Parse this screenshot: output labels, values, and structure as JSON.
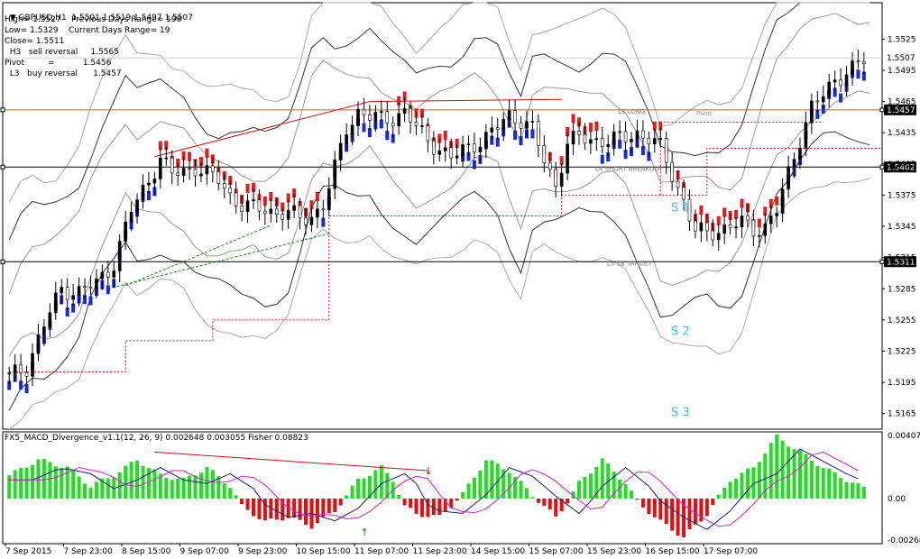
{
  "symbol_header": "GBPUSD,H1  1.5501 1.5519 1.5497 1.5507",
  "info_lines": [
    "High= 1.5527    Previous Days Range= 198",
    "Low= 1.5329    Current Days Range= 19",
    "Close= 1.5511",
    "  H3   sell reversal     1.5565",
    "Pivot         =           1.5456",
    "  L3   buy reversal      1.5457"
  ],
  "indicator_title": "FX5_MACD_Divergence_v1.1(12, 26, 9) 0.002648 0.003055  Fisher 0.08823",
  "chart_data": [
    {
      "type": "candlestick",
      "symbol": "GBPUSD",
      "timeframe": "H1",
      "ylim": [
        1.515,
        1.556
      ],
      "ytick_labels": [
        "1.5525",
        "1.5495",
        "1.5465",
        "1.5435",
        "1.5405",
        "1.5375",
        "1.5345",
        "1.5315",
        "1.5285",
        "1.5255",
        "1.5225",
        "1.5195",
        "1.5165"
      ],
      "xtick_labels": [
        "7 Sep 2015",
        "7 Sep 23:00",
        "8 Sep 15:00",
        "9 Sep 07:00",
        "9 Sep 23:00",
        "10 Sep 15:00",
        "11 Sep 07:00",
        "11 Sep 23:00",
        "14 Sep 15:00",
        "15 Sep 07:00",
        "15 Sep 23:00",
        "16 Sep 15:00",
        "17 Sep 07:00"
      ],
      "close_path": [
        [
          0,
          1.52
        ],
        [
          3,
          1.521
        ],
        [
          6,
          1.525
        ],
        [
          9,
          1.5285
        ],
        [
          12,
          1.5282
        ],
        [
          15,
          1.529
        ],
        [
          18,
          1.531
        ],
        [
          21,
          1.536
        ],
        [
          24,
          1.539
        ],
        [
          26,
          1.541
        ],
        [
          28,
          1.5395
        ],
        [
          30,
          1.5398
        ],
        [
          32,
          1.5402
        ],
        [
          34,
          1.5395
        ],
        [
          36,
          1.539
        ],
        [
          38,
          1.5375
        ],
        [
          40,
          1.5365
        ],
        [
          42,
          1.5362
        ],
        [
          44,
          1.5362
        ],
        [
          46,
          1.5358
        ],
        [
          48,
          1.5358
        ],
        [
          50,
          1.5352
        ],
        [
          52,
          1.5355
        ],
        [
          54,
          1.5365
        ],
        [
          56,
          1.54
        ],
        [
          58,
          1.544
        ],
        [
          60,
          1.5455
        ],
        [
          62,
          1.545
        ],
        [
          64,
          1.5448
        ],
        [
          66,
          1.545
        ],
        [
          68,
          1.5455
        ],
        [
          70,
          1.544
        ],
        [
          72,
          1.5428
        ],
        [
          74,
          1.542
        ],
        [
          76,
          1.541
        ],
        [
          78,
          1.5418
        ],
        [
          80,
          1.5425
        ],
        [
          82,
          1.543
        ],
        [
          84,
          1.544
        ],
        [
          86,
          1.5452
        ],
        [
          88,
          1.5448
        ],
        [
          90,
          1.5438
        ],
        [
          92,
          1.5408
        ],
        [
          94,
          1.5385
        ],
        [
          96,
          1.5425
        ],
        [
          98,
          1.543
        ],
        [
          100,
          1.5428
        ],
        [
          102,
          1.5428
        ],
        [
          104,
          1.5428
        ],
        [
          106,
          1.543
        ],
        [
          108,
          1.5435
        ],
        [
          110,
          1.543
        ],
        [
          112,
          1.542
        ],
        [
          114,
          1.5395
        ],
        [
          116,
          1.537
        ],
        [
          118,
          1.534
        ],
        [
          120,
          1.5338
        ],
        [
          122,
          1.5342
        ],
        [
          124,
          1.5345
        ],
        [
          126,
          1.5348
        ],
        [
          128,
          1.5342
        ],
        [
          130,
          1.5345
        ],
        [
          132,
          1.536
        ],
        [
          134,
          1.5395
        ],
        [
          136,
          1.543
        ],
        [
          138,
          1.546
        ],
        [
          140,
          1.547
        ],
        [
          142,
          1.5485
        ],
        [
          144,
          1.5495
        ],
        [
          146,
          1.55
        ],
        [
          148,
          1.5507
        ]
      ],
      "bar_count": 150,
      "horizontal_lines": [
        {
          "value": 1.5457,
          "label": "1.5457",
          "color": "#cc6600",
          "text": "L3 LONG"
        },
        {
          "value": 1.5402,
          "label": "1.5402",
          "color": "#000000",
          "text": "L4 SHORT BREAKOUT"
        },
        {
          "value": 1.5311,
          "label": "1.5311",
          "color": "#000000",
          "text": "L5 SB TARGET"
        }
      ],
      "pivot_label": "Pivot",
      "support_labels": [
        "S 1",
        "S 2",
        "S 3"
      ],
      "support_values": [
        1.5363,
        1.5244,
        1.5166
      ],
      "current_price_label": "1.5507",
      "current_price": 1.5507,
      "colors": {
        "up_trend": "#1a2bd4",
        "down_trend": "#dd2020",
        "candle": "#000000",
        "level_line": "#cc6600",
        "support_text": "#44c6d8",
        "red_dash": "#cc1111",
        "green_dash": "#118811"
      }
    },
    {
      "type": "histogram",
      "name": "FX5_MACD_Divergence_v1.1",
      "ylim": [
        -0.00268,
        0.00407
      ],
      "ytick_labels": [
        "0.00407",
        "0.00",
        "-0.00268"
      ],
      "values_profile": [
        [
          0,
          0.0015
        ],
        [
          5,
          0.0025
        ],
        [
          10,
          0.002
        ],
        [
          14,
          0.0008
        ],
        [
          18,
          0.0015
        ],
        [
          22,
          0.0025
        ],
        [
          26,
          0.0015
        ],
        [
          30,
          0.0012
        ],
        [
          34,
          0.002
        ],
        [
          38,
          0.0008
        ],
        [
          40,
          -0.0005
        ],
        [
          44,
          -0.0015
        ],
        [
          48,
          -0.0012
        ],
        [
          52,
          -0.0018
        ],
        [
          56,
          -0.0008
        ],
        [
          60,
          0.0012
        ],
        [
          64,
          0.002
        ],
        [
          66,
          0.0012
        ],
        [
          68,
          -0.0005
        ],
        [
          70,
          -0.001
        ],
        [
          74,
          -0.0012
        ],
        [
          78,
          0.0003
        ],
        [
          82,
          0.0025
        ],
        [
          86,
          0.0018
        ],
        [
          90,
          0.0002
        ],
        [
          92,
          -0.0005
        ],
        [
          94,
          -0.0012
        ],
        [
          96,
          -0.0002
        ],
        [
          98,
          0.001
        ],
        [
          102,
          0.0025
        ],
        [
          106,
          0.001
        ],
        [
          108,
          -0.0002
        ],
        [
          112,
          -0.0015
        ],
        [
          116,
          -0.0025
        ],
        [
          120,
          -0.001
        ],
        [
          124,
          0.0012
        ],
        [
          128,
          0.002
        ],
        [
          132,
          0.004
        ],
        [
          136,
          0.003
        ],
        [
          140,
          0.002
        ],
        [
          144,
          0.0012
        ],
        [
          148,
          0.0005
        ]
      ],
      "arrows": [
        "↓",
        "↑"
      ],
      "colors": {
        "positive": "#22dd22",
        "negative": "#dd1111",
        "macd_line": "#1a1a6e",
        "signal_line": "#cc22cc"
      }
    }
  ]
}
